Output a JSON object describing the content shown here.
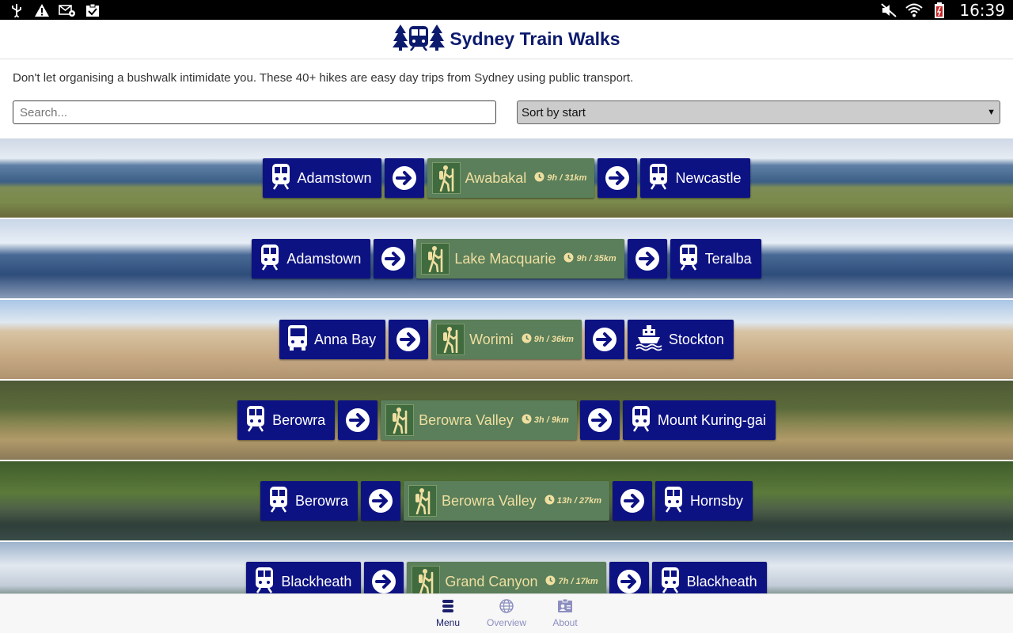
{
  "status": {
    "time": "16:39"
  },
  "app": {
    "title": "Sydney Train Walks"
  },
  "intro": "Don't let organising a bushwalk intimidate you. These 40+ hikes are easy day trips from Sydney using public transport.",
  "search": {
    "placeholder": "Search..."
  },
  "sort": {
    "selected": "Sort by start"
  },
  "walks": [
    {
      "start": "Adamstown",
      "start_icon": "train-icon",
      "walk": "Awabakal",
      "duration": "9h / 31km",
      "end": "Newcastle",
      "end_icon": "train-icon"
    },
    {
      "start": "Adamstown",
      "start_icon": "train-icon",
      "walk": "Lake Macquarie",
      "duration": "9h / 35km",
      "end": "Teralba",
      "end_icon": "train-icon"
    },
    {
      "start": "Anna Bay",
      "start_icon": "bus-icon",
      "walk": "Worimi",
      "duration": "9h / 36km",
      "end": "Stockton",
      "end_icon": "ferry-icon"
    },
    {
      "start": "Berowra",
      "start_icon": "train-icon",
      "walk": "Berowra Valley",
      "duration": "3h / 9km",
      "end": "Mount Kuring-gai",
      "end_icon": "train-icon"
    },
    {
      "start": "Berowra",
      "start_icon": "train-icon",
      "walk": "Berowra Valley",
      "duration": "13h / 27km",
      "end": "Hornsby",
      "end_icon": "train-icon"
    },
    {
      "start": "Blackheath",
      "start_icon": "train-icon",
      "walk": "Grand Canyon",
      "duration": "7h / 17km",
      "end": "Blackheath",
      "end_icon": "train-icon"
    }
  ],
  "nav": {
    "menu": "Menu",
    "overview": "Overview",
    "about": "About"
  }
}
